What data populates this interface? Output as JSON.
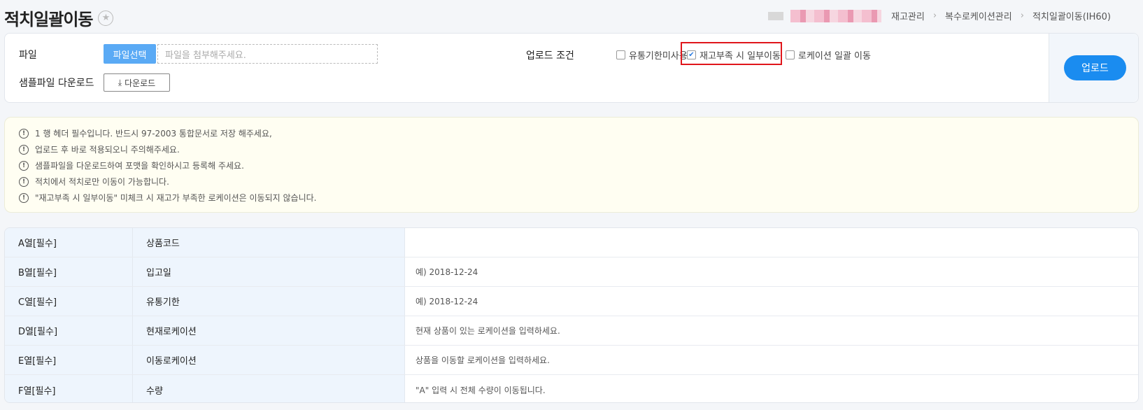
{
  "page": {
    "title": "적치일괄이동",
    "favorite_icon": "star-icon"
  },
  "breadcrumb": [
    "재고관리",
    "복수로케이션관리",
    "적치일괄이동(IH60)"
  ],
  "upload": {
    "file_label": "파일",
    "file_button": "파일선택",
    "file_placeholder": "파일을 첨부해주세요.",
    "sample_label": "샘플파일 다운로드",
    "download_button": "다운로드",
    "condition_label": "업로드 조건",
    "options": [
      {
        "label": "유통기한미사용",
        "checked": false
      },
      {
        "label": "재고부족 시 일부이동",
        "checked": true
      },
      {
        "label": "로케이션 일괄 이동",
        "checked": false
      }
    ],
    "upload_button": "업로드"
  },
  "notices": [
    "1 행 헤더 필수입니다. 반드시 97-2003 통합문서로 저장 해주세요,",
    "업로드 후 바로 적용되오니 주의해주세요.",
    "샘플파일을 다운로드하여 포맷을 확인하시고 등록해 주세요.",
    "적치에서 적치로만 이동이 가능합니다.",
    "\"재고부족 시 일부이동\" 미체크 시 재고가 부족한 로케이션은 이동되지 않습니다."
  ],
  "columns": [
    {
      "col": "A열[필수]",
      "name": "상품코드",
      "desc": ""
    },
    {
      "col": "B열[필수]",
      "name": "입고일",
      "desc": "예) 2018-12-24"
    },
    {
      "col": "C열[필수]",
      "name": "유통기한",
      "desc": "예) 2018-12-24"
    },
    {
      "col": "D열[필수]",
      "name": "현재로케이션",
      "desc": "현재 상품이 있는 로케이션을 입력하세요."
    },
    {
      "col": "E열[필수]",
      "name": "이동로케이션",
      "desc": "상품을 이동할 로케이션을 입력하세요."
    },
    {
      "col": "F열[필수]",
      "name": "수량",
      "desc": "\"A\" 입력 시 전체 수량이 이동됩니다."
    }
  ],
  "colors": {
    "accent": "#1a8cf0",
    "file_button": "#5aaaf5",
    "highlight": "#e0161b"
  }
}
